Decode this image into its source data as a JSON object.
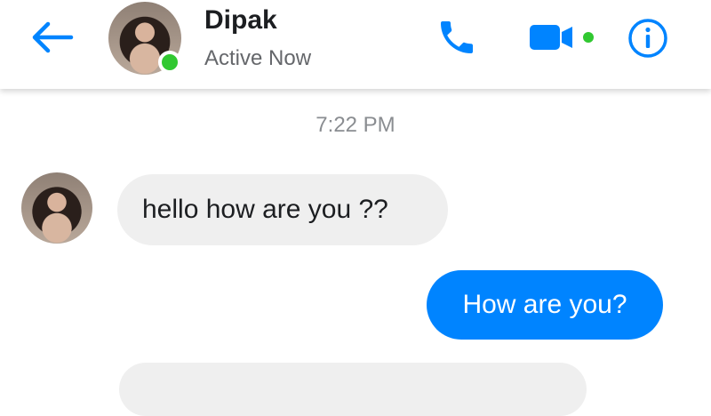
{
  "header": {
    "contact_name": "Dipak",
    "status": "Active Now",
    "online": true,
    "icons": {
      "back": "back-arrow-icon",
      "call": "phone-icon",
      "video": "video-camera-icon",
      "info": "info-icon"
    }
  },
  "conversation": {
    "timestamp": "7:22 PM",
    "messages": [
      {
        "direction": "incoming",
        "text": "hello how are you ??"
      },
      {
        "direction": "outgoing",
        "text": "How are you?"
      },
      {
        "direction": "incoming",
        "text": ""
      }
    ]
  },
  "colors": {
    "accent": "#0084ff",
    "online": "#31c831",
    "incoming_bubble": "#efefef",
    "outgoing_bubble": "#0084ff"
  }
}
